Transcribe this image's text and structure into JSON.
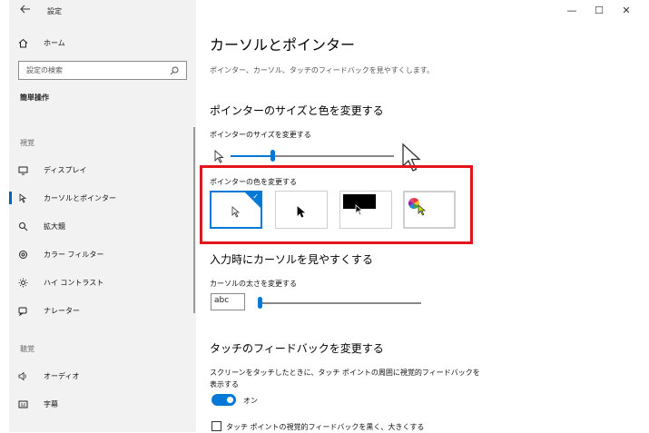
{
  "window": {
    "back_icon": "arrow-left-icon",
    "title": "設定",
    "controls": [
      "—",
      "☐",
      "✕"
    ]
  },
  "sidebar": {
    "home_label": "ホーム",
    "search_placeholder": "設定の検索",
    "category": "簡単操作",
    "groups": [
      {
        "label": "視覚"
      },
      {
        "label": "聴覚"
      }
    ],
    "items": [
      {
        "label": "ディスプレイ",
        "icon": "display-icon"
      },
      {
        "label": "カーソルとポインター",
        "icon": "cursor-icon",
        "active": true
      },
      {
        "label": "拡大鏡",
        "icon": "magnifier-icon"
      },
      {
        "label": "カラー フィルター",
        "icon": "color-filter-icon"
      },
      {
        "label": "ハイ コントラスト",
        "icon": "high-contrast-icon"
      },
      {
        "label": "ナレーター",
        "icon": "narrator-icon"
      },
      {
        "label": "オーディオ",
        "icon": "audio-icon"
      },
      {
        "label": "字幕",
        "icon": "captions-icon"
      }
    ]
  },
  "main": {
    "title": "カーソルとポインター",
    "description": "ポインター、カーソル、タッチのフィードバックを見やすくします。",
    "pointer_section": {
      "heading": "ポインターのサイズと色を変更する",
      "size_label": "ポインターのサイズを変更する",
      "size_value": 0.25,
      "color_label": "ポインターの色を変更する",
      "color_options": [
        "white",
        "black",
        "inverted",
        "custom"
      ],
      "selected_color": "white"
    },
    "cursor_section": {
      "heading": "入力時にカーソルを見やすくする",
      "thickness_label": "カーソルの太さを変更する",
      "preview_text": "abc",
      "thickness_value": 0.0
    },
    "touch_section": {
      "heading": "タッチのフィードバックを変更する",
      "toggle_desc_line1": "スクリーンをタッチしたときに、タッチ ポイントの周囲に視覚的フィードバックを",
      "toggle_desc_line2": "表示する",
      "toggle_state": "オン",
      "checkbox_label": "タッチ ポイントの視覚的フィードバックを黒く、大きくする"
    }
  },
  "colors": {
    "accent": "#0078d7",
    "highlight": "#e3141b",
    "sidebar_bg": "#f2f2f2"
  }
}
